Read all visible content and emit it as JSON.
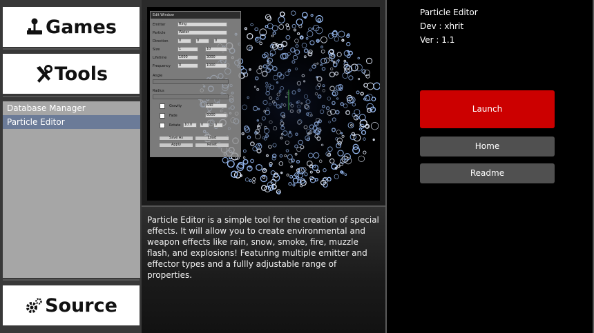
{
  "categories": {
    "games": {
      "label": "Games",
      "icon": "joystick-icon"
    },
    "tools": {
      "label": "Tools",
      "icon": "tools-icon"
    },
    "source": {
      "label": "Source",
      "icon": "gears-icon"
    }
  },
  "tool_list": [
    {
      "label": "Database Manager",
      "selected": false
    },
    {
      "label": "Particle Editor",
      "selected": true
    }
  ],
  "preview": {
    "edit_window": {
      "title": "Edit Window",
      "emitter_label": "Emitter",
      "emitter_value": "Ring",
      "particle_label": "Particle",
      "particle_value": "Water",
      "direction_label": "Direction",
      "direction_values": [
        "0",
        "0",
        "0"
      ],
      "size_label": "Size",
      "size_values": [
        "1",
        "10"
      ],
      "lifetime_label": "Lifetime",
      "lifetime_values": [
        "1000",
        "3000"
      ],
      "frequency_label": "Frequency",
      "frequency_values": [
        "0",
        "1000"
      ],
      "angle_label": "Angle",
      "radius_label": "Radius",
      "check1_label": "Gravity",
      "check1_value": "640",
      "check2_label": "Fade",
      "check2_value": "6000",
      "check3_label": "Rotate",
      "check3_values": [
        "10.0",
        "0",
        "0"
      ],
      "save_label": "Save As",
      "load_label": "Load",
      "apply_label": "Apply",
      "reset_label": "Reset"
    }
  },
  "description": "Particle Editor is a simple tool for the creation of special effects. It will allow you to create environmental and weapon effects like rain, snow, smoke, fire, muzzle flash, and explosions! Featuring multiple emitter and effector types and a fullly adjustable range of properties.",
  "info": {
    "name": "Particle Editor",
    "dev": "Dev : xhrit",
    "version": "Ver : 1.1"
  },
  "buttons": {
    "launch": "Launch",
    "home": "Home",
    "readme": "Readme"
  },
  "colors": {
    "launch": "#cc0000",
    "selected_item": "#6b7b98",
    "list_bg": "#a6a6a6"
  }
}
